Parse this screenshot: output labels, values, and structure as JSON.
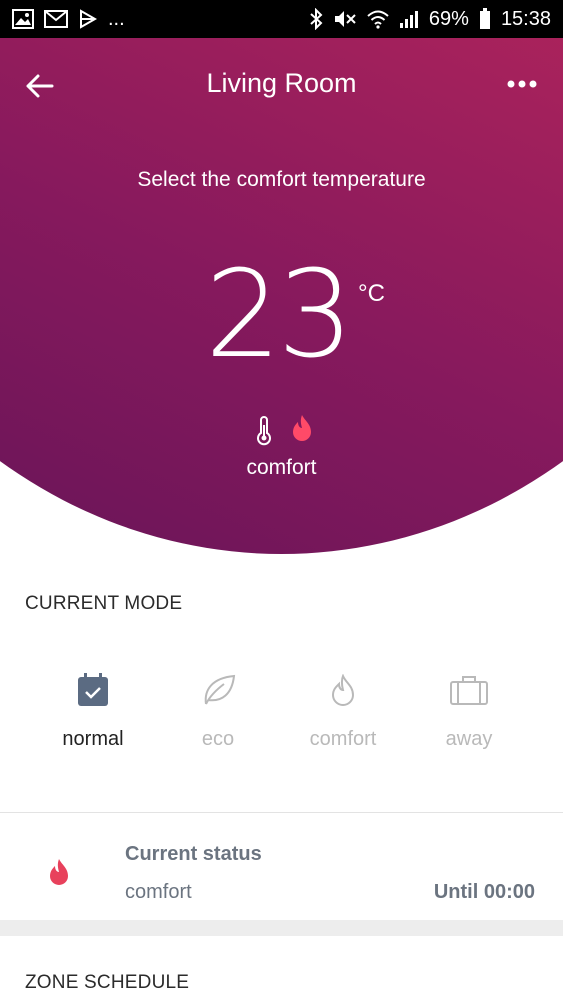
{
  "status_bar": {
    "battery_percent": "69%",
    "time": "15:38",
    "overflow": "..."
  },
  "header": {
    "title": "Living Room"
  },
  "hero": {
    "prompt": "Select the comfort temperature",
    "temperature": "23",
    "unit": "°C",
    "mode": "comfort"
  },
  "current_mode": {
    "title": "CURRENT MODE",
    "items": [
      {
        "label": "normal",
        "active": true
      },
      {
        "label": "eco",
        "active": false
      },
      {
        "label": "comfort",
        "active": false
      },
      {
        "label": "away",
        "active": false
      }
    ]
  },
  "current_status": {
    "title": "Current status",
    "value": "comfort",
    "until": "Until 00:00"
  },
  "zone_schedule": {
    "title": "ZONE SCHEDULE"
  },
  "colors": {
    "accent": "#e8415c",
    "active_text": "#222222",
    "inactive": "#b9b9b9",
    "icon_active": "#5b6b82"
  }
}
